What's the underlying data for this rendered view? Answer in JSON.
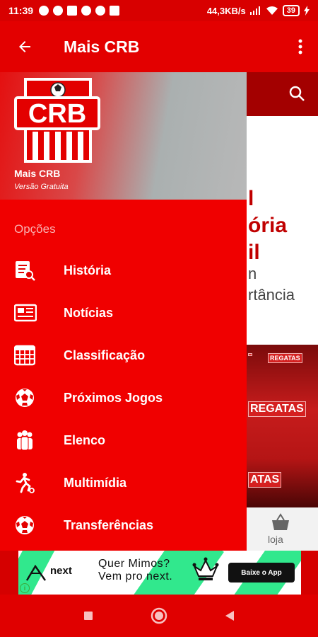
{
  "status_bar": {
    "time": "11:39",
    "network_speed": "44,3KB/s",
    "battery": "39"
  },
  "app_bar": {
    "title": "Mais CRB"
  },
  "drawer": {
    "logo_text": "CRB",
    "app_name": "Mais CRB",
    "app_version": "Versão Gratuita",
    "section_label": "Opções",
    "items": [
      {
        "label": "História",
        "icon": "history-icon"
      },
      {
        "label": "Notícias",
        "icon": "news-icon"
      },
      {
        "label": "Classificação",
        "icon": "table-icon"
      },
      {
        "label": "Próximos Jogos",
        "icon": "soccer-ball-icon"
      },
      {
        "label": "Elenco",
        "icon": "team-icon"
      },
      {
        "label": "Multimídia",
        "icon": "player-icon"
      },
      {
        "label": "Transferências",
        "icon": "soccer-ball-icon"
      }
    ]
  },
  "background": {
    "heading_lines": [
      "l",
      "ória",
      "il"
    ],
    "body_lines": [
      "n",
      "rtância"
    ],
    "banner_words": [
      "REGATAS",
      "REGATAS",
      "ATAS"
    ],
    "bottom_tab_label": "loja"
  },
  "ad": {
    "brand": "next",
    "line1": "Quer Mimos?",
    "line2": "Vem pro next.",
    "cta": "Baixe o App",
    "info": "i"
  },
  "colors": {
    "primary": "#e30000",
    "drawer": "#f00000",
    "ad_accent": "#31e88d"
  }
}
